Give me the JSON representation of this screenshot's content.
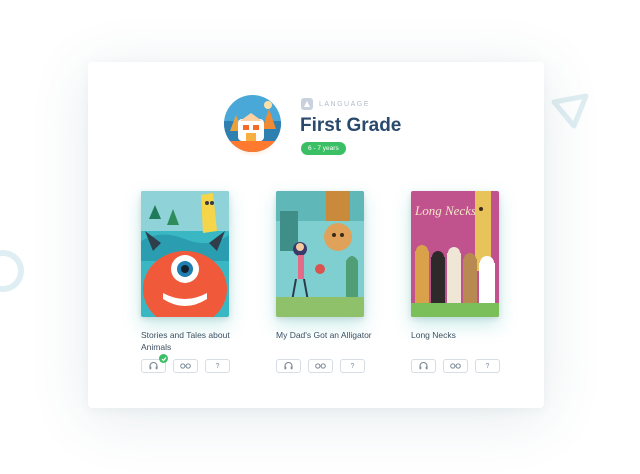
{
  "colors": {
    "accent_green": "#3bbf64",
    "title_blue": "#2a4a6d",
    "decor": "#dfeef2"
  },
  "header": {
    "subject_icon": "language-icon",
    "subject_label": "LANGUAGE",
    "title": "First Grade",
    "age_badge": "6 - 7 years"
  },
  "books": [
    {
      "title": "Stories and Tales about Animals",
      "actions": [
        {
          "icon": "headphones-icon",
          "completed": true
        },
        {
          "icon": "glasses-icon",
          "completed": false
        },
        {
          "icon": "question-icon",
          "completed": false
        }
      ]
    },
    {
      "title": "My Dad's Got an Alligator",
      "actions": [
        {
          "icon": "headphones-icon",
          "completed": false
        },
        {
          "icon": "glasses-icon",
          "completed": false
        },
        {
          "icon": "question-icon",
          "completed": false
        }
      ]
    },
    {
      "title": "Long Necks",
      "cover_text": "Long Necks",
      "actions": [
        {
          "icon": "headphones-icon",
          "completed": false
        },
        {
          "icon": "glasses-icon",
          "completed": false
        },
        {
          "icon": "question-icon",
          "completed": false
        }
      ]
    }
  ]
}
